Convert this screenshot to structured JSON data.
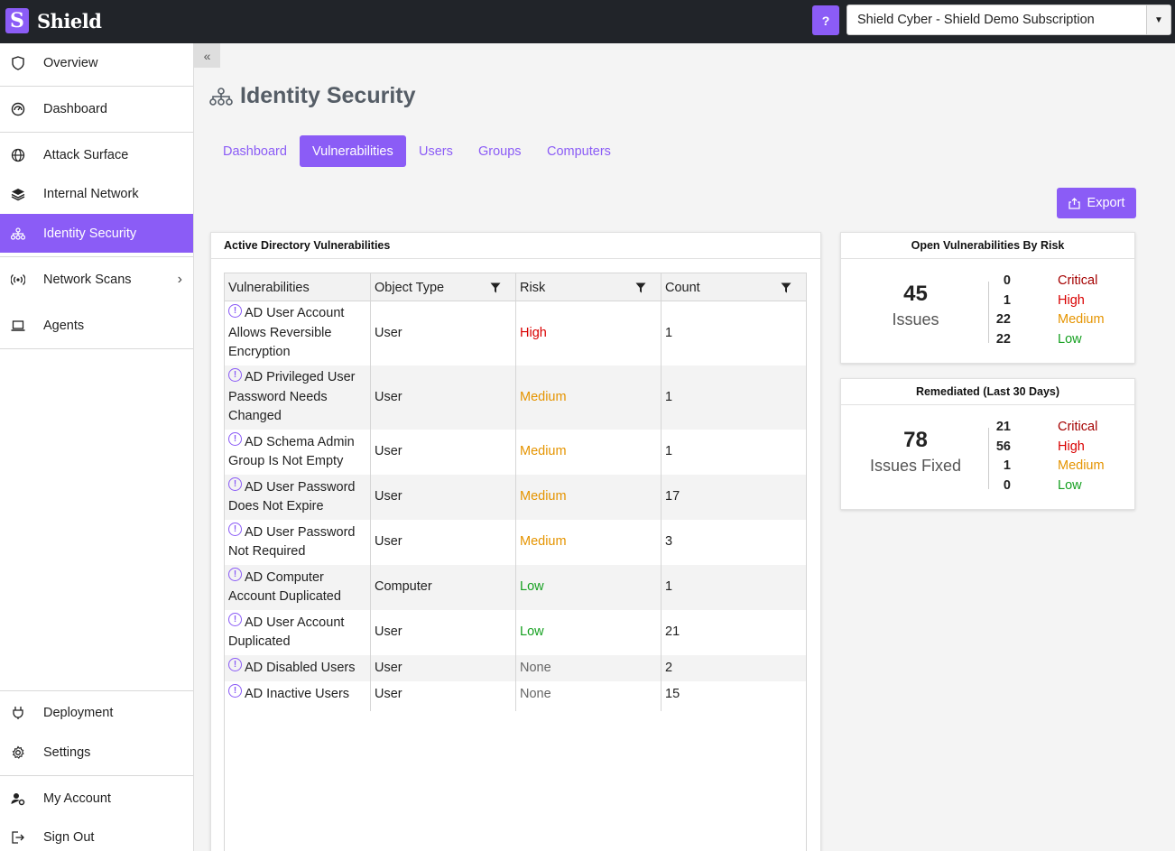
{
  "app": {
    "logo_letter": "S",
    "name": "Shield"
  },
  "topbar": {
    "help_label": "?",
    "subscription": "Shield Cyber - Shield Demo Subscription",
    "caret": "▼"
  },
  "sidebar": {
    "items": [
      {
        "label": "Overview",
        "icon": "shield-icon"
      },
      {
        "label": "Dashboard",
        "icon": "gauge-icon"
      },
      {
        "label": "Attack Surface",
        "icon": "globe-icon"
      },
      {
        "label": "Internal Network",
        "icon": "layers-icon"
      },
      {
        "label": "Identity Security",
        "icon": "hierarchy-icon",
        "active": true
      },
      {
        "label": "Network Scans",
        "icon": "broadcast-icon",
        "chevron": "›"
      },
      {
        "label": "Agents",
        "icon": "laptop-icon"
      },
      {
        "label": "Deployment",
        "icon": "plug-icon"
      },
      {
        "label": "Settings",
        "icon": "gear-icon"
      },
      {
        "label": "My Account",
        "icon": "user-gear-icon"
      },
      {
        "label": "Sign Out",
        "icon": "sign-out-icon"
      }
    ]
  },
  "page": {
    "title": "Identity Security",
    "collapse_label": "«"
  },
  "tabs": [
    {
      "label": "Dashboard"
    },
    {
      "label": "Vulnerabilities",
      "active": true
    },
    {
      "label": "Users"
    },
    {
      "label": "Groups"
    },
    {
      "label": "Computers"
    }
  ],
  "export_label": "Export",
  "vulnerabilities": {
    "title": "Active Directory Vulnerabilities",
    "columns": [
      "Vulnerabilities",
      "Object Type",
      "Risk",
      "Count"
    ],
    "rows": [
      {
        "name": "AD User Account Allows Reversible Encryption",
        "type": "User",
        "risk": "High",
        "count": "1"
      },
      {
        "name": "AD Privileged User Password Needs Changed",
        "type": "User",
        "risk": "Medium",
        "count": "1"
      },
      {
        "name": "AD Schema Admin Group Is Not Empty",
        "type": "User",
        "risk": "Medium",
        "count": "1"
      },
      {
        "name": "AD User Password Does Not Expire",
        "type": "User",
        "risk": "Medium",
        "count": "17"
      },
      {
        "name": "AD User Password Not Required",
        "type": "User",
        "risk": "Medium",
        "count": "3"
      },
      {
        "name": "AD Computer Account Duplicated",
        "type": "Computer",
        "risk": "Low",
        "count": "1"
      },
      {
        "name": "AD User Account Duplicated",
        "type": "User",
        "risk": "Low",
        "count": "21"
      },
      {
        "name": "AD Disabled Users",
        "type": "User",
        "risk": "None",
        "count": "2"
      },
      {
        "name": "AD Inactive Users",
        "type": "User",
        "risk": "None",
        "count": "15"
      }
    ]
  },
  "open_by_risk": {
    "title": "Open Vulnerabilities By Risk",
    "total": "45",
    "total_label": "Issues",
    "breakdown": [
      {
        "count": "0",
        "label": "Critical"
      },
      {
        "count": "1",
        "label": "High"
      },
      {
        "count": "22",
        "label": "Medium"
      },
      {
        "count": "22",
        "label": "Low"
      }
    ]
  },
  "remediated": {
    "title": "Remediated (Last 30 Days)",
    "total": "78",
    "total_label": "Issues Fixed",
    "breakdown": [
      {
        "count": "21",
        "label": "Critical"
      },
      {
        "count": "56",
        "label": "High"
      },
      {
        "count": "1",
        "label": "Medium"
      },
      {
        "count": "0",
        "label": "Low"
      }
    ]
  },
  "colors": {
    "accent": "#8b5cf6",
    "critical": "#a40000",
    "high": "#d90000",
    "medium": "#e59400",
    "low": "#15a020",
    "none": "#666666"
  }
}
